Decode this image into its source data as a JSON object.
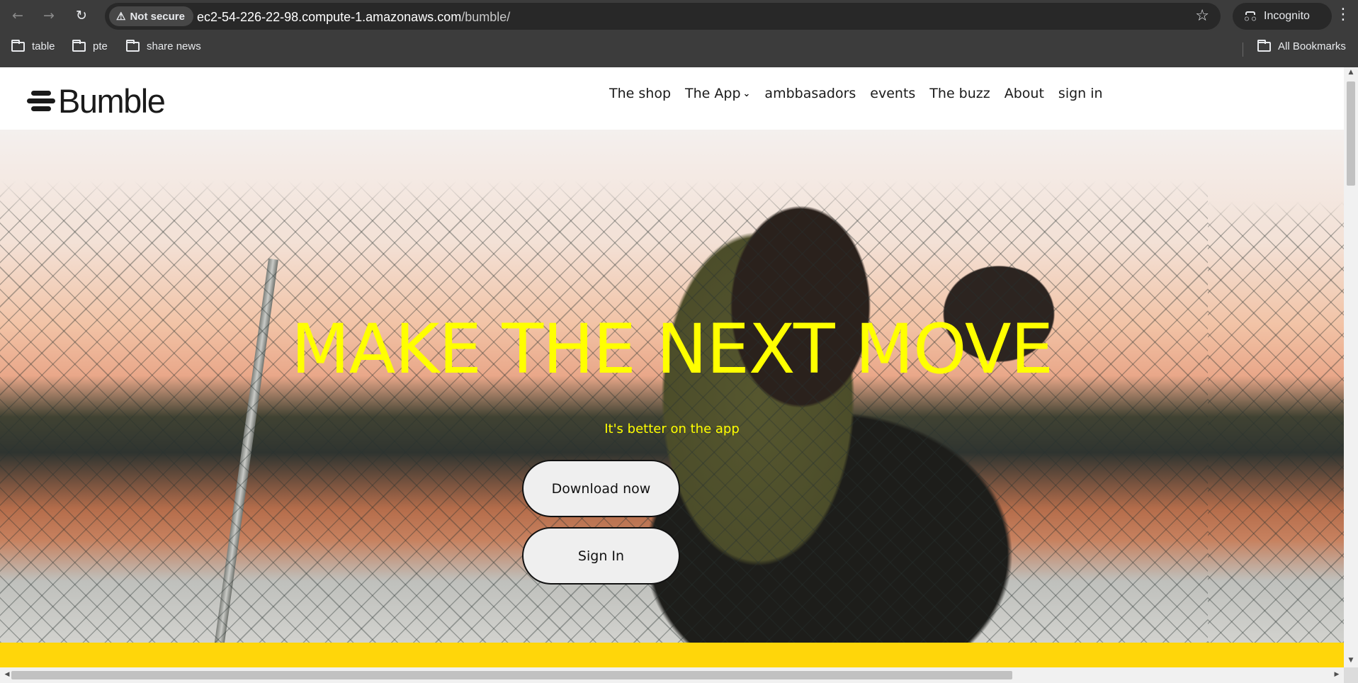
{
  "browser": {
    "security_label": "Not secure",
    "url_host": "ec2-54-226-22-98.compute-1.amazonaws.com",
    "url_path": "/bumble/",
    "profile_label": "Incognito",
    "bookmarks": [
      {
        "label": "table",
        "icon": "folder-icon"
      },
      {
        "label": "pte",
        "icon": "folder-icon"
      },
      {
        "label": "share news",
        "icon": "folder-icon"
      }
    ],
    "all_bookmarks_label": "All Bookmarks"
  },
  "site": {
    "logo_text": "Bumble",
    "nav": [
      {
        "label": "The shop"
      },
      {
        "label": "The App",
        "has_dropdown": true
      },
      {
        "label": "ambbasadors"
      },
      {
        "label": "events"
      },
      {
        "label": "The buzz"
      },
      {
        "label": "About"
      },
      {
        "label": "sign in"
      }
    ]
  },
  "hero": {
    "title": "MAKE THE NEXT MOVE",
    "subtitle": "It's better on the app",
    "download_button": "Download now",
    "signin_button": "Sign In",
    "title_color": "#ffff00",
    "band_color": "#ffd60a"
  }
}
